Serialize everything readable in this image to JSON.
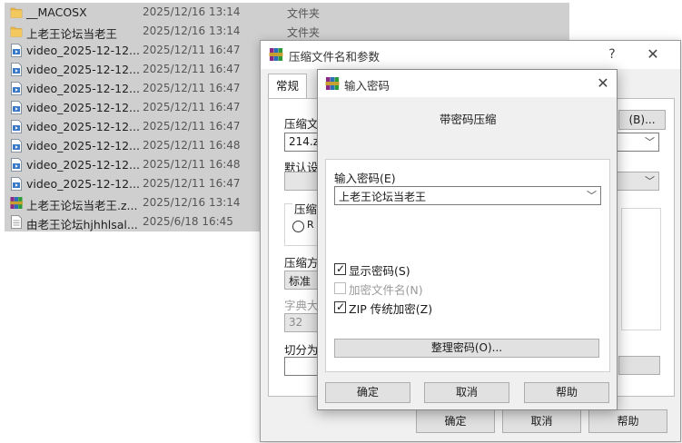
{
  "explorer": {
    "files": [
      {
        "name": "__MACOSX",
        "date": "2025/12/16 13:14",
        "type": "文件夹",
        "icon": "folder-icon"
      },
      {
        "name": "上老王论坛当老王",
        "date": "2025/12/16 13:14",
        "type": "文件夹",
        "icon": "folder-icon"
      },
      {
        "name": "video_2025-12-12...",
        "date": "2025/12/11 16:47",
        "type": "",
        "icon": "video-file-icon"
      },
      {
        "name": "video_2025-12-12...",
        "date": "2025/12/11 16:47",
        "type": "",
        "icon": "video-file-icon"
      },
      {
        "name": "video_2025-12-12...",
        "date": "2025/12/11 16:47",
        "type": "",
        "icon": "video-file-icon"
      },
      {
        "name": "video_2025-12-12...",
        "date": "2025/12/11 16:47",
        "type": "",
        "icon": "video-file-icon"
      },
      {
        "name": "video_2025-12-12...",
        "date": "2025/12/11 16:47",
        "type": "",
        "icon": "video-file-icon"
      },
      {
        "name": "video_2025-12-12...",
        "date": "2025/12/11 16:48",
        "type": "",
        "icon": "video-file-icon"
      },
      {
        "name": "video_2025-12-12...",
        "date": "2025/12/11 16:48",
        "type": "",
        "icon": "video-file-icon"
      },
      {
        "name": "video_2025-12-12...",
        "date": "2025/12/11 16:47",
        "type": "",
        "icon": "video-file-icon"
      },
      {
        "name": "上老王论坛当老王.z...",
        "date": "2025/12/16 13:14",
        "type": "",
        "icon": "winrar-archive-icon"
      },
      {
        "name": "由老王论坛hjhhlsal...",
        "date": "2025/6/18 16:45",
        "type": "",
        "icon": "text-file-icon"
      }
    ]
  },
  "main_dialog": {
    "title": "压缩文件名和参数",
    "help_glyph": "?",
    "close_glyph": "✕",
    "tab_general": "常规",
    "archive_name_label": "压缩文",
    "browse_button": "(B)...",
    "archive_name_value": "214.zip",
    "default_profile_label": "默认设",
    "format_group_label": "压缩",
    "radio_label": "R",
    "method_label": "压缩方",
    "method_value": "标准",
    "dict_label": "字典大",
    "dict_value": "32",
    "split_label": "切分为",
    "ok_button": "确定",
    "cancel_button": "取消",
    "help_button": "帮助"
  },
  "password_dialog": {
    "title": "输入密码",
    "close_glyph": "✕",
    "heading": "带密码压缩",
    "password_label": "输入密码(E)",
    "password_value": "上老王论坛当老王",
    "show_password_label": "显示密码(S)",
    "show_password_checked": true,
    "encrypt_names_label": "加密文件名(N)",
    "encrypt_names_checked": false,
    "zip_legacy_label": "ZIP 传统加密(Z)",
    "zip_legacy_checked": true,
    "organize_button": "整理密码(O)...",
    "ok_button": "确定",
    "cancel_button": "取消",
    "help_button": "帮助"
  },
  "colors": {
    "row_selected": "#cfcfcf",
    "folder": "#e8b64a",
    "dialog_bg": "#f0f0f0",
    "button_bg": "#e1e1e1"
  }
}
